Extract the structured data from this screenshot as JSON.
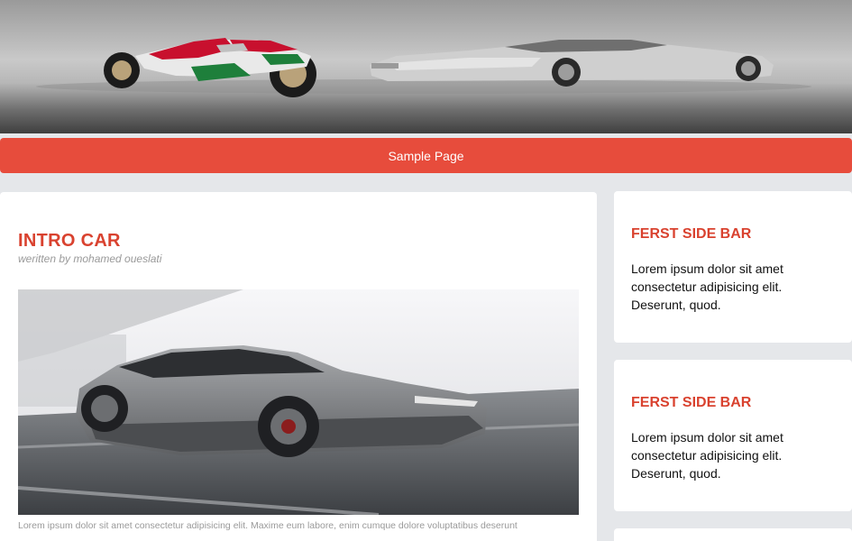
{
  "hero": {
    "image": "car-and-motorcycle-banner"
  },
  "nav": {
    "link_label": "Sample Page",
    "accent": "#e74c3c"
  },
  "article": {
    "title": "INTRO CAR",
    "byline": "weritten by mohamed oueslati",
    "image": "silver-sedan-photo",
    "excerpt": "Lorem ipsum dolor sit amet consectetur adipisicing elit. Maxime eum labore, enim cumque dolore voluptatibus deserunt"
  },
  "sidebar": [
    {
      "title": "FERST SIDE BAR",
      "text": "Lorem ipsum dolor sit amet consectetur adipisicing elit. Deserunt, quod."
    },
    {
      "title": "FERST SIDE BAR",
      "text": "Lorem ipsum dolor sit amet consectetur adipisicing elit. Deserunt, quod."
    }
  ],
  "colors": {
    "title_red": "#d9422f",
    "background": "#e5e7ea"
  }
}
